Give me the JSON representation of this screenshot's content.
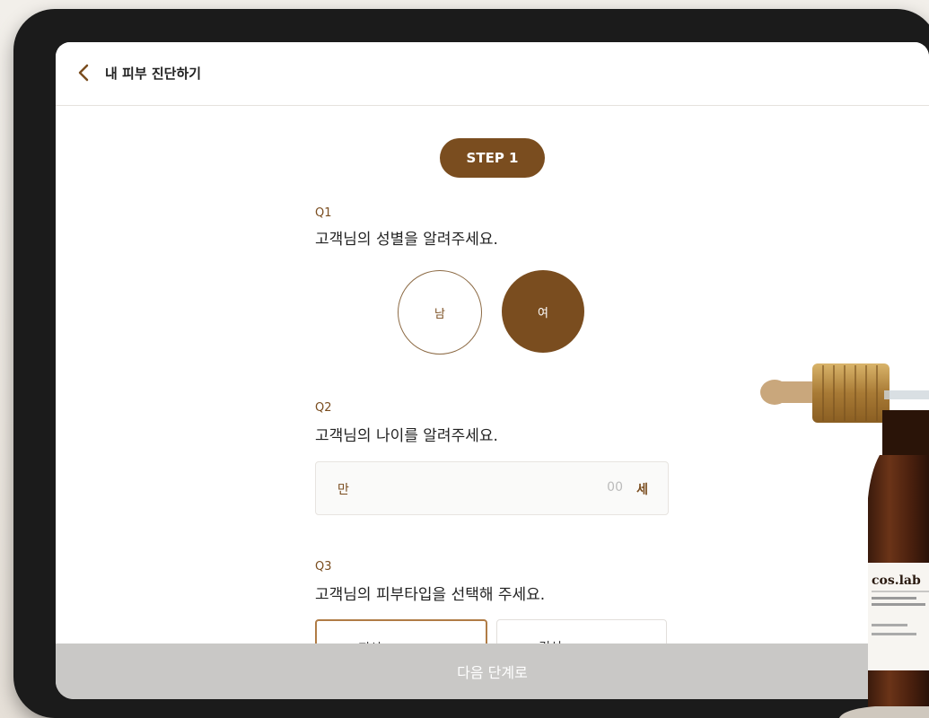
{
  "header": {
    "title": "내 피부 진단하기"
  },
  "step": {
    "label": "STEP 1"
  },
  "q1": {
    "number": "Q1",
    "text": "고객님의 성별을 알려주세요.",
    "options": [
      "남",
      "여"
    ],
    "selected": "여"
  },
  "q2": {
    "number": "Q2",
    "text": "고객님의 나이를 알려주세요.",
    "prefix": "만",
    "placeholder": "00",
    "suffix": "세"
  },
  "q3": {
    "number": "Q3",
    "text": "고객님의 피부타입을 선택해 주세요.",
    "options": [
      "✓ 지성",
      "✓ 건성"
    ]
  },
  "footer": {
    "next_label": "다음 단계로"
  },
  "product": {
    "brand": "cos.lab"
  },
  "colors": {
    "accent": "#7a4d1f",
    "disabled": "#c9c8c6"
  }
}
